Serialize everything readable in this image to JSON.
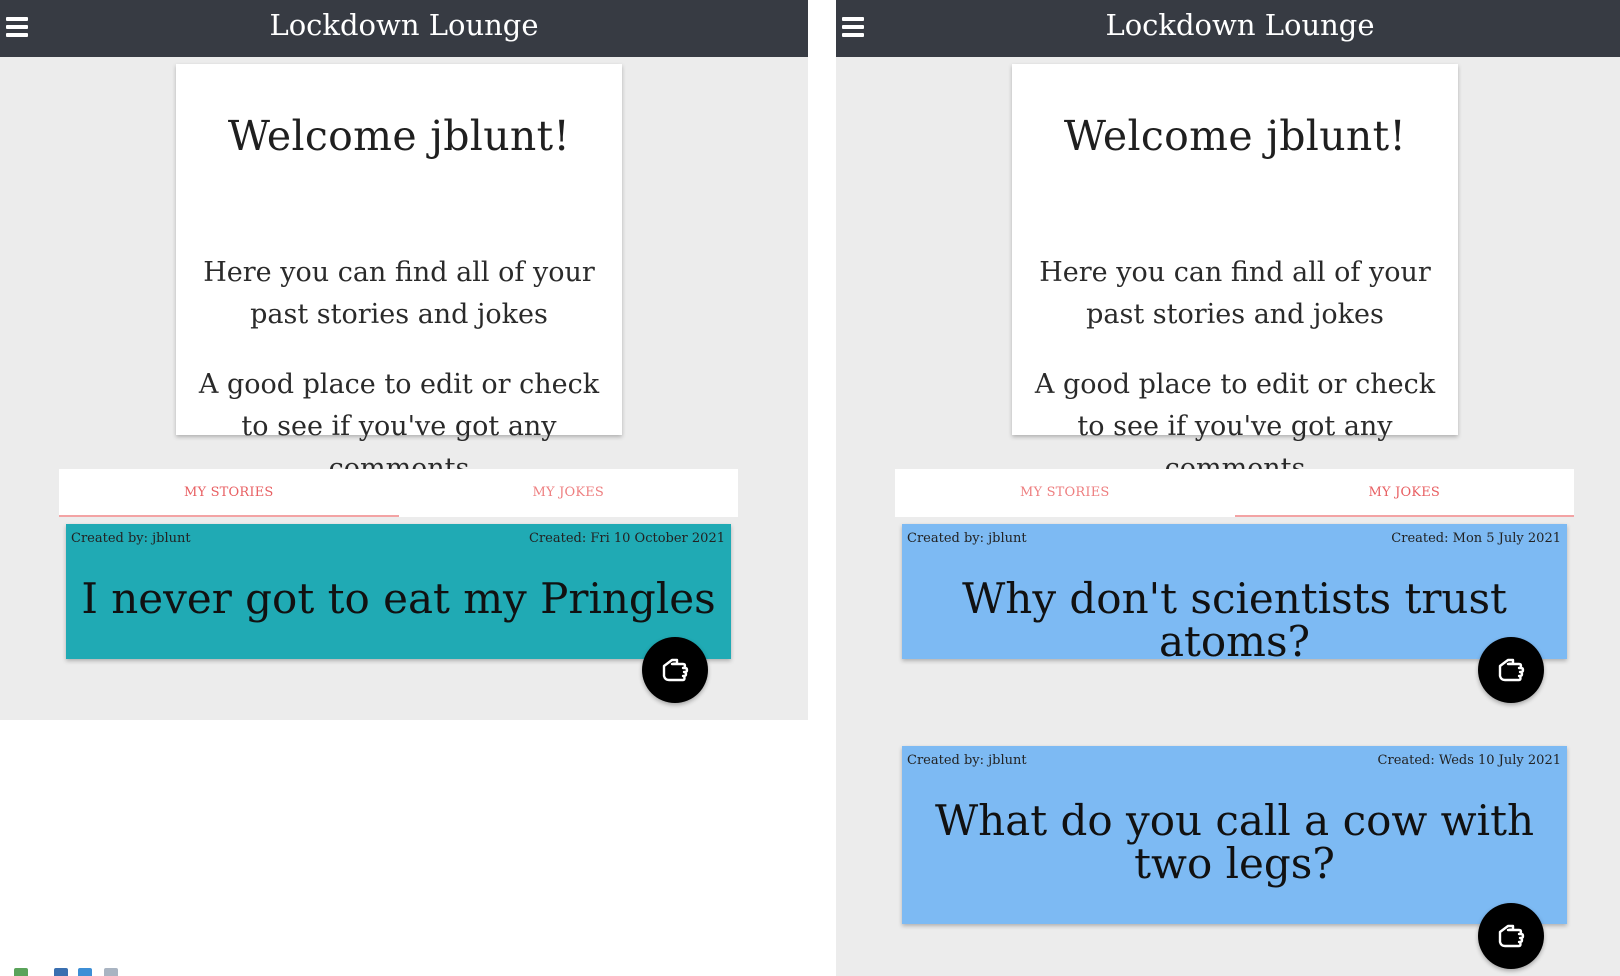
{
  "colors": {
    "navbar": "#373b43",
    "page_bg": "#ececec",
    "tab_text": "#ee7f80",
    "story_card": "#20aab4",
    "joke_card": "#7dbaf3",
    "fab": "#000000"
  },
  "panels": [
    {
      "navbar": {
        "brand": "Lockdown Lounge",
        "menu_icon": "hamburger-menu-icon"
      },
      "welcome": {
        "title": "Welcome jblunt!",
        "line1": "Here you can find all of your past stories and jokes",
        "line2": "A good place to edit or check to see if you've got any comments"
      },
      "tabs": {
        "stories": "MY STORIES",
        "jokes": "MY JOKES",
        "active": "stories"
      },
      "posts": [
        {
          "author": "Created by: jblunt",
          "date": "Created: Fri 10 October 2021",
          "title": "I never got to eat my Pringles",
          "fab_icon": "pointing-hand-icon"
        }
      ]
    },
    {
      "navbar": {
        "brand": "Lockdown Lounge",
        "menu_icon": "hamburger-menu-icon"
      },
      "welcome": {
        "title": "Welcome jblunt!",
        "line1": "Here you can find all of your past stories and jokes",
        "line2": "A good place to edit or check to see if you've got any comments"
      },
      "tabs": {
        "stories": "MY STORIES",
        "jokes": "MY JOKES",
        "active": "jokes"
      },
      "posts": [
        {
          "author": "Created by: jblunt",
          "date": "Created: Mon 5 July 2021",
          "title": "Why don't scientists trust atoms?",
          "fab_icon": "pointing-hand-icon"
        },
        {
          "author": "Created by: jblunt",
          "date": "Created: Weds 10 July 2021",
          "title": "What do you call a cow with two legs?",
          "fab_icon": "pointing-hand-icon"
        }
      ]
    }
  ]
}
